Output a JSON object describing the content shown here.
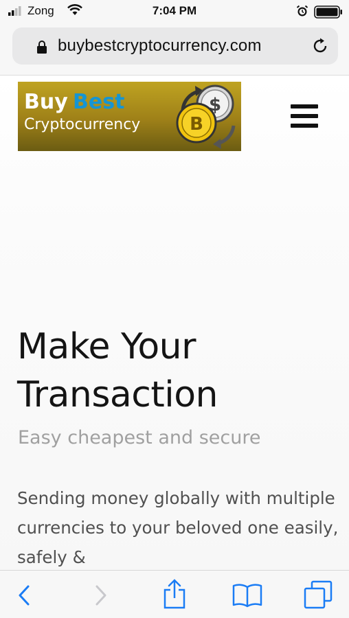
{
  "status_bar": {
    "carrier": "Zong",
    "time": "7:04 PM",
    "signal_icon": "signal-bars-icon",
    "wifi_icon": "wifi-icon",
    "alarm_icon": "alarm-icon",
    "battery_icon": "battery-icon"
  },
  "address_bar": {
    "url": "buybestcryptocurrency.com",
    "lock_icon": "lock-icon",
    "reload_icon": "reload-icon"
  },
  "header": {
    "logo_word_1": "Buy",
    "logo_word_2": "Best",
    "logo_line_2": "Cryptocurrency",
    "menu_icon": "hamburger-menu-icon"
  },
  "hero": {
    "title": "Make Your Transaction",
    "subtitle": "Easy cheapest and secure",
    "body": "Sending money globally with multiple currencies to your beloved one easily, safely &"
  },
  "toolbar": {
    "items": [
      "back-icon",
      "forward-icon",
      "share-icon",
      "bookmarks-icon",
      "tabs-icon"
    ]
  },
  "colors": {
    "logo_best": "#1595d3",
    "ios_blue": "#1a7cf5",
    "subtitle": "#a0a0a0"
  }
}
